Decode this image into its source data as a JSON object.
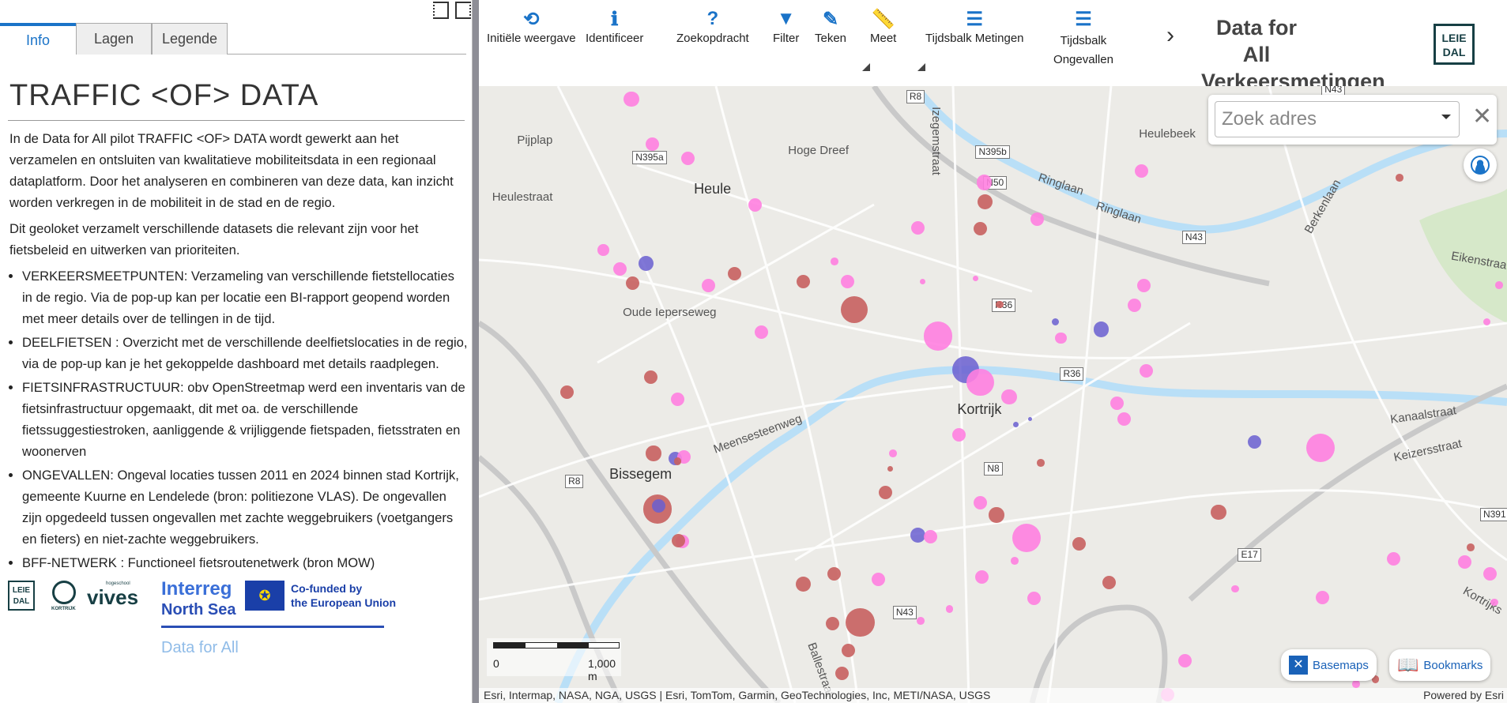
{
  "left_panel": {
    "tabs": [
      {
        "label": "Info",
        "active": true
      },
      {
        "label": "Lagen"
      },
      {
        "label": "Legende"
      }
    ],
    "title": "TRAFFIC <OF> DATA",
    "intro": [
      "In de Data for All pilot TRAFFIC <OF> DATA wordt gewerkt aan het verzamelen en ontsluiten van kwalitatieve mobiliteitsdata in een regionaal dataplatform. Door het analyseren en combineren van deze data, kan inzicht worden verkregen in de mobiliteit in de stad en de regio.",
      "Dit geoloket verzamelt verschillende datasets die relevant zijn voor het fietsbeleid en uitwerken van prioriteiten."
    ],
    "bullets": [
      "VERKEERSMEETPUNTEN: Verzameling van verschillende fietstellocaties in de regio. Via de pop-up kan per locatie een BI-rapport geopend worden met meer details over de tellingen in de tijd.",
      "DEELFIETSEN : Overzicht met de verschillende deelfietslocaties in de regio, via de pop-up kan je het gekoppelde dashboard met details raadplegen.",
      "FIETSINFRASTRUCTUUR: obv OpenStreetmap werd een inventaris van de fietsinfrastructuur opgemaakt, dit met oa. de verschillende fietssuggestiestroken, aanliggende & vrijliggende fietspaden, fietsstraten en woonerven",
      "ONGEVALLEN: Ongeval locaties tussen 2011 en 2024 binnen stad Kortrijk, gemeente Kuurne en Lendelede (bron: politiezone VLAS). De ongevallen zijn opgedeeld tussen ongevallen met zachte weggebruikers (voetgangers en fieters) en niet-zachte weggebruikers.",
      "BFF-NETWERK : Functioneel fietsroutenetwerk (bron MOW)"
    ],
    "logos": {
      "leiedal": "LEIE DAL",
      "kortrijk": "KORTRIJK",
      "vives": "vives",
      "vives_sub": "hogeschool",
      "interreg_1": "Interreg",
      "interreg_2": "North Sea",
      "eu_1": "Co-funded by",
      "eu_2": "the European Union",
      "dfa": "Data for All"
    }
  },
  "toolbar": {
    "tools": [
      {
        "label": "Initiële weergave",
        "icon": "home-reset-icon"
      },
      {
        "label": "Identificeer",
        "icon": "identify-icon"
      },
      {
        "label": "Zoekopdracht",
        "icon": "query-icon"
      },
      {
        "label": "Filter",
        "icon": "filter-icon"
      },
      {
        "label": "Teken",
        "icon": "pencil-icon"
      },
      {
        "label": "Meet",
        "icon": "measure-icon"
      },
      {
        "label": "Tijdsbalk Metingen",
        "icon": "timeslider-icon"
      },
      {
        "label": "Tijdsbalk Ongevallen",
        "icon": "timeslider-icon"
      }
    ],
    "more": "›",
    "app_title": "Data for All Verkeersmetingen",
    "logo": "LEIE DAL",
    "accent": "#1a73c8"
  },
  "map": {
    "search_placeholder": "Zoek adres",
    "places": [
      "Heule",
      "Heulestraat",
      "Pijplap",
      "Hoge Dreef",
      "Heulebeek",
      "Ringlaan",
      "Ringlaan",
      "Berkenlaan",
      "Eikenstraat",
      "Oude Ieperseweg",
      "Kortrijk",
      "Meensesteenweg",
      "Kanaalstraat",
      "Keizersstraat",
      "Bissegem",
      "Izegemstraat",
      "Ballestraat",
      "Kortrijks"
    ],
    "shields": [
      "R8",
      "N43",
      "N395a",
      "N395b",
      "N50",
      "N43",
      "R36",
      "R36",
      "N8",
      "R8",
      "N43",
      "E17",
      "N391"
    ],
    "scale": {
      "left": "0",
      "right": "1,000 m"
    },
    "basemaps": "Basemaps",
    "bookmarks": "Bookmarks",
    "attribution": "Esri, Intermap, NASA, NGA, USGS | Esri, TomTom, Garmin, GeoTechnologies, Inc, METI/NASA, USGS",
    "powered": "Powered by Esri",
    "colors": {
      "soft_users": "#ff80e0",
      "other": "#c8605f",
      "counts": "#6a5fd0",
      "water": "#b9dff7"
    }
  }
}
